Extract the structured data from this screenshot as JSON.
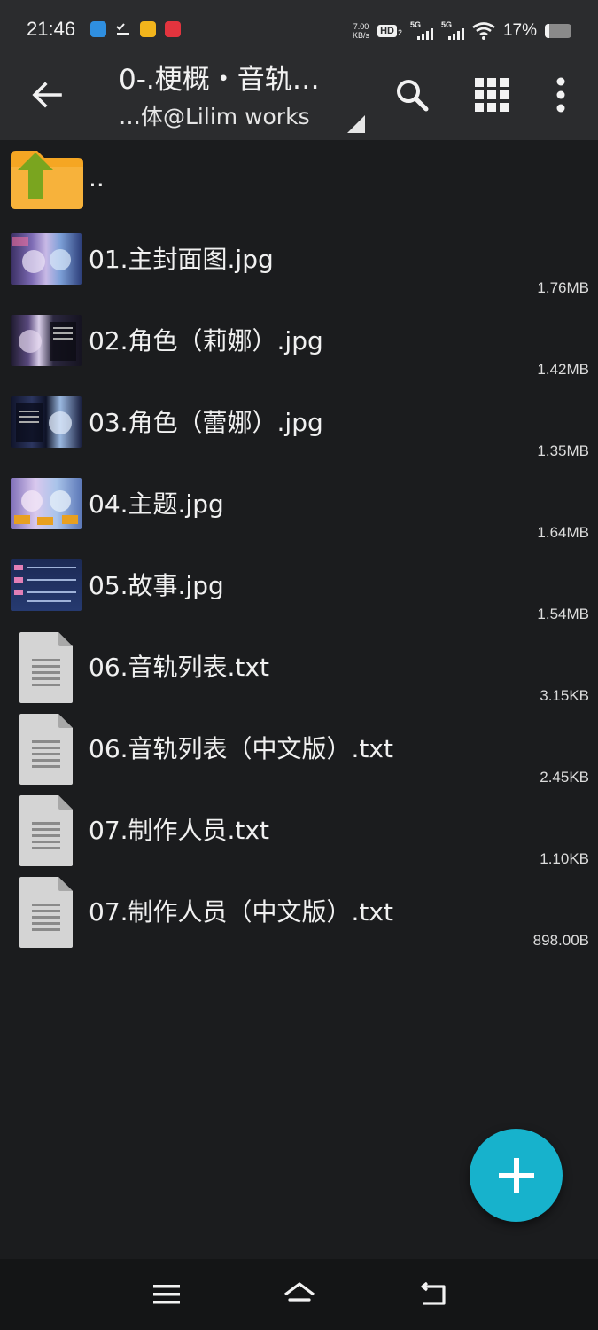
{
  "status_bar": {
    "time": "21:46",
    "net_speed_value": "7.00",
    "net_speed_unit": "KB/s",
    "hd_label": "HD",
    "hd_sub": "2",
    "sim1_label": "5G",
    "sim2_label": "5G",
    "battery_percent": "17%",
    "battery_level": 0.17
  },
  "app_bar": {
    "title": "0-.梗概・音轨…",
    "subtitle": "…体@Lilim works",
    "icons": [
      "back-arrow-icon",
      "search-icon",
      "grid-view-icon",
      "more-vert-icon"
    ]
  },
  "files": [
    {
      "name": "..",
      "size": "",
      "type": "parent-folder"
    },
    {
      "name": "01.主封面图.jpg",
      "size": "1.76MB",
      "type": "image"
    },
    {
      "name": "02.角色（莉娜）.jpg",
      "size": "1.42MB",
      "type": "image"
    },
    {
      "name": "03.角色（蕾娜）.jpg",
      "size": "1.35MB",
      "type": "image"
    },
    {
      "name": "04.主题.jpg",
      "size": "1.64MB",
      "type": "image"
    },
    {
      "name": "05.故事.jpg",
      "size": "1.54MB",
      "type": "image"
    },
    {
      "name": "06.音轨列表.txt",
      "size": "3.15KB",
      "type": "text"
    },
    {
      "name": "06.音轨列表（中文版）.txt",
      "size": "2.45KB",
      "type": "text"
    },
    {
      "name": "07.制作人员.txt",
      "size": "1.10KB",
      "type": "text"
    },
    {
      "name": "07.制作人员（中文版）.txt",
      "size": "898.00B",
      "type": "text"
    }
  ],
  "fab": {
    "icon": "plus-icon",
    "color": "#17b2cc"
  },
  "nav_bar": {
    "icons": [
      "menu-icon",
      "home-icon",
      "back-icon"
    ]
  },
  "colors": {
    "background": "#1b1c1e",
    "app_bar": "#2b2c2e",
    "folder": "#f5a623",
    "folder_arrow": "#7aa51f"
  }
}
